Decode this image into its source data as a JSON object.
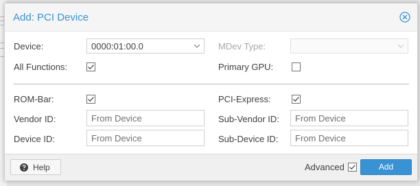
{
  "dialog": {
    "title": "Add: PCI Device"
  },
  "form": {
    "device": {
      "label": "Device:",
      "value": "0000:01:00.0"
    },
    "mdev_type": {
      "label": "MDev Type:",
      "value": ""
    },
    "all_functions": {
      "label": "All Functions:",
      "checked": true
    },
    "primary_gpu": {
      "label": "Primary GPU:",
      "checked": false
    },
    "rom_bar": {
      "label": "ROM-Bar:",
      "checked": true
    },
    "pci_express": {
      "label": "PCI-Express:",
      "checked": true
    },
    "vendor_id": {
      "label": "Vendor ID:",
      "placeholder": "From Device"
    },
    "sub_vendor_id": {
      "label": "Sub-Vendor ID:",
      "placeholder": "From Device"
    },
    "device_id": {
      "label": "Device ID:",
      "placeholder": "From Device"
    },
    "sub_device_id": {
      "label": "Sub-Device ID:",
      "placeholder": "From Device"
    }
  },
  "footer": {
    "help_label": "Help",
    "advanced_label": "Advanced",
    "advanced_checked": true,
    "add_label": "Add"
  },
  "colors": {
    "accent": "#3892d4",
    "title": "#3892d4"
  }
}
